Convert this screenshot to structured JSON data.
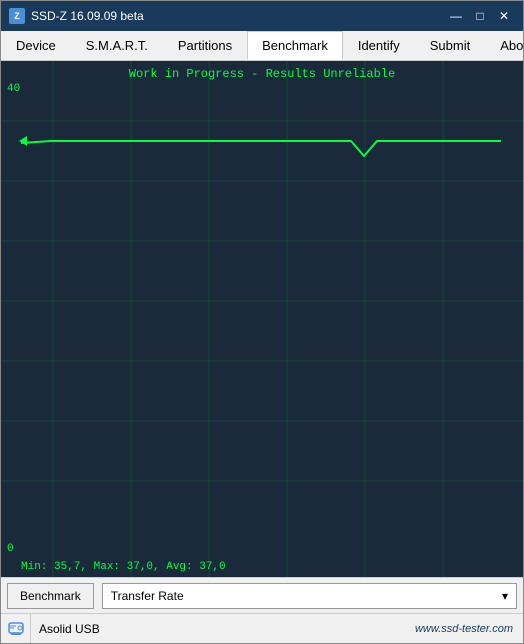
{
  "window": {
    "title": "SSD-Z 16.09.09 beta",
    "icon_label": "Z"
  },
  "title_controls": {
    "minimize": "—",
    "maximize": "□",
    "close": "✕"
  },
  "menu": {
    "items": [
      {
        "id": "device",
        "label": "Device"
      },
      {
        "id": "smart",
        "label": "S.M.A.R.T."
      },
      {
        "id": "partitions",
        "label": "Partitions"
      },
      {
        "id": "benchmark",
        "label": "Benchmark",
        "active": true
      },
      {
        "id": "identify",
        "label": "Identify"
      },
      {
        "id": "submit",
        "label": "Submit"
      },
      {
        "id": "about",
        "label": "About"
      }
    ]
  },
  "chart": {
    "warning_text": "Work in Progress - Results Unreliable",
    "y_max": "40",
    "y_min": "0",
    "stats_text": "Min: 35,7, Max: 37,0, Avg: 37,0",
    "line_color": "#00ff41",
    "bg_color": "#1a2a3a",
    "grid_color": "rgba(0,180,60,0.2)"
  },
  "benchmark_bar": {
    "button_label": "Benchmark",
    "dropdown_label": "Transfer Rate",
    "dropdown_arrow": "▾"
  },
  "status_bar": {
    "device_name": "Asolid USB",
    "brand_text": "www.ssd-tester.com"
  }
}
